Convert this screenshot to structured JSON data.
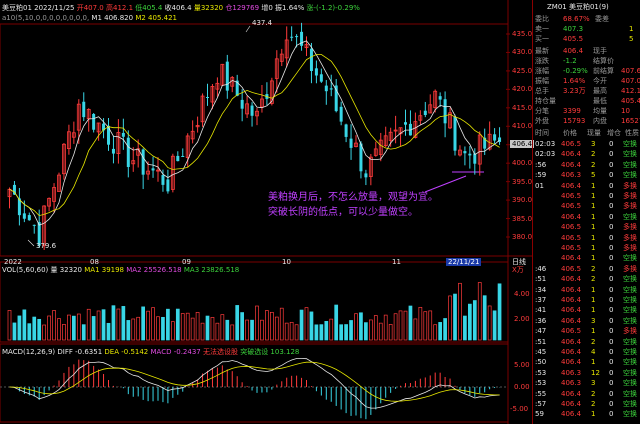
{
  "header": {
    "title": "美豆粕01 2022/11/25",
    "open": "开407.0",
    "high": "高412.1",
    "low": "低405.4",
    "close": "收406.4",
    "volume": "量32320",
    "position": "仓129769",
    "position_change": "增0",
    "amplitude": "振1.64%",
    "change": "涨-(-1.2)-0.29%",
    "ma_row": "a10(5,10,0,0,0,0,0,0,0,0,",
    "ma_row_2": "M1 406.820",
    "ma_row_3": "M2 405.421"
  },
  "price_axis": {
    "ticks": [
      "435.0",
      "430.0",
      "425.0",
      "420.0",
      "415.0",
      "410.0",
      "405.0",
      "400.0",
      "395.0",
      "390.0",
      "385.0",
      "380.0"
    ],
    "current_label": "406.4",
    "high_label": "437.4",
    "low_label": "379.6"
  },
  "time_axis": {
    "labels": [
      "2022",
      "08",
      "09",
      "10",
      "11"
    ],
    "current_date": "22/11/21",
    "period_label": "日线"
  },
  "annotation": {
    "line1": "美粕换月后，不怎么放量，观望为宜。",
    "line2": "突破长阴的低点，可以少量做空。"
  },
  "volume_panel": {
    "label": "VOL(5,60,60)",
    "vol": "量 32320",
    "ma1": "MA1 39198",
    "ma2": "MA2 25526.518",
    "ma3": "MA3 23826.518",
    "unit": "X万",
    "ticks": [
      "4.00",
      "2.00"
    ]
  },
  "macd_panel": {
    "label": "MACD(12,26,9)",
    "diff": "DIFF -0.6351",
    "dea": "DEA -0.5142",
    "macd": "MACD -0.2437",
    "extra1": "无法选设股",
    "extra2": "突破选设 103.128",
    "ticks": [
      "5.00",
      "0.00",
      "-5.00"
    ]
  },
  "quote_panel": {
    "title": "ZM01 美豆粕01(9)",
    "book": [
      {
        "l": "委比",
        "v": "68.67%",
        "l2": "委差",
        "v2": "",
        "c": "red"
      },
      {
        "l": "卖一",
        "v": "407.3",
        "l2": "",
        "v2": "1",
        "c": "grn"
      },
      {
        "l": "买一",
        "v": "405.5",
        "l2": "",
        "v2": "5",
        "c": "red"
      }
    ],
    "stats": [
      {
        "l": "最新",
        "v": "406.4",
        "l2": "现手",
        "v2": ""
      },
      {
        "l": "涨跌",
        "v": "-1.2",
        "l2": "结算价",
        "v2": ""
      },
      {
        "l": "涨幅",
        "v": "-0.29%",
        "l2": "前结算",
        "v2": "407.6"
      },
      {
        "l": "振幅",
        "v": "1.64%",
        "l2": "今开",
        "v2": "407.0"
      },
      {
        "l": "总手",
        "v": "3.23万",
        "l2": "最高",
        "v2": "412.1"
      },
      {
        "l": "持仓量",
        "v": "",
        "l2": "最低",
        "v2": "405.4"
      },
      {
        "l": "分笔",
        "v": "3399",
        "l2": "均量",
        "v2": "10"
      },
      {
        "l": "外盘",
        "v": "15793",
        "l2": "内盘",
        "v2": "16527"
      }
    ],
    "tick_header": [
      "时间",
      "价格",
      "现量",
      "增仓",
      "性质"
    ],
    "ticks": [
      {
        "t": "02:03",
        "p": "406.5",
        "q": "3",
        "d": "0",
        "n": "空换"
      },
      {
        "t": "02:03",
        "p": "406.4",
        "q": "2",
        "d": "0",
        "n": "空换"
      },
      {
        "t": ":56",
        "p": "406.4",
        "q": "2",
        "d": "0",
        "n": "空换"
      },
      {
        "t": ":59",
        "p": "406.3",
        "q": "5",
        "d": "0",
        "n": "空换"
      },
      {
        "t": "01",
        "p": "406.4",
        "q": "1",
        "d": "0",
        "n": "多换"
      },
      {
        "t": "",
        "p": "406.5",
        "q": "1",
        "d": "0",
        "n": "多换"
      },
      {
        "t": "",
        "p": "406.5",
        "q": "1",
        "d": "0",
        "n": "多换"
      },
      {
        "t": "",
        "p": "406.4",
        "q": "1",
        "d": "0",
        "n": "空换"
      },
      {
        "t": "",
        "p": "406.5",
        "q": "1",
        "d": "0",
        "n": "多换"
      },
      {
        "t": "",
        "p": "406.5",
        "q": "1",
        "d": "0",
        "n": "多换"
      },
      {
        "t": "",
        "p": "406.5",
        "q": "1",
        "d": "0",
        "n": "多换"
      },
      {
        "t": "",
        "p": "406.4",
        "q": "1",
        "d": "0",
        "n": "空换"
      },
      {
        "t": ":46",
        "p": "406.5",
        "q": "2",
        "d": "0",
        "n": "多换"
      },
      {
        "t": ":51",
        "p": "406.4",
        "q": "2",
        "d": "0",
        "n": "空换"
      },
      {
        "t": ":34",
        "p": "406.4",
        "q": "1",
        "d": "0",
        "n": "空换"
      },
      {
        "t": ":37",
        "p": "406.4",
        "q": "1",
        "d": "0",
        "n": "空换"
      },
      {
        "t": ":41",
        "p": "406.4",
        "q": "1",
        "d": "0",
        "n": "空换"
      },
      {
        "t": ":36",
        "p": "406.4",
        "q": "3",
        "d": "0",
        "n": "空换"
      },
      {
        "t": ":47",
        "p": "406.5",
        "q": "1",
        "d": "0",
        "n": "多换"
      },
      {
        "t": ":51",
        "p": "406.4",
        "q": "2",
        "d": "0",
        "n": "空换"
      },
      {
        "t": ":45",
        "p": "406.4",
        "q": "4",
        "d": "0",
        "n": "空换"
      },
      {
        "t": ":50",
        "p": "406.4",
        "q": "1",
        "d": "0",
        "n": "空换"
      },
      {
        "t": ":53",
        "p": "406.3",
        "q": "12",
        "d": "0",
        "n": "空换"
      },
      {
        "t": ":53",
        "p": "406.3",
        "q": "3",
        "d": "0",
        "n": "空换"
      },
      {
        "t": ":55",
        "p": "406.4",
        "q": "2",
        "d": "0",
        "n": "空换"
      },
      {
        "t": ":57",
        "p": "406.4",
        "q": "2",
        "d": "0",
        "n": "空换"
      },
      {
        "t": "59",
        "p": "406.4",
        "q": "1",
        "d": "0",
        "n": "空换"
      }
    ]
  },
  "colors": {
    "up": "#ff3b3b",
    "down": "#39d6e6",
    "ma5": "#e8e8e8",
    "ma10": "#e6e600",
    "grid": "#7a0000"
  }
}
